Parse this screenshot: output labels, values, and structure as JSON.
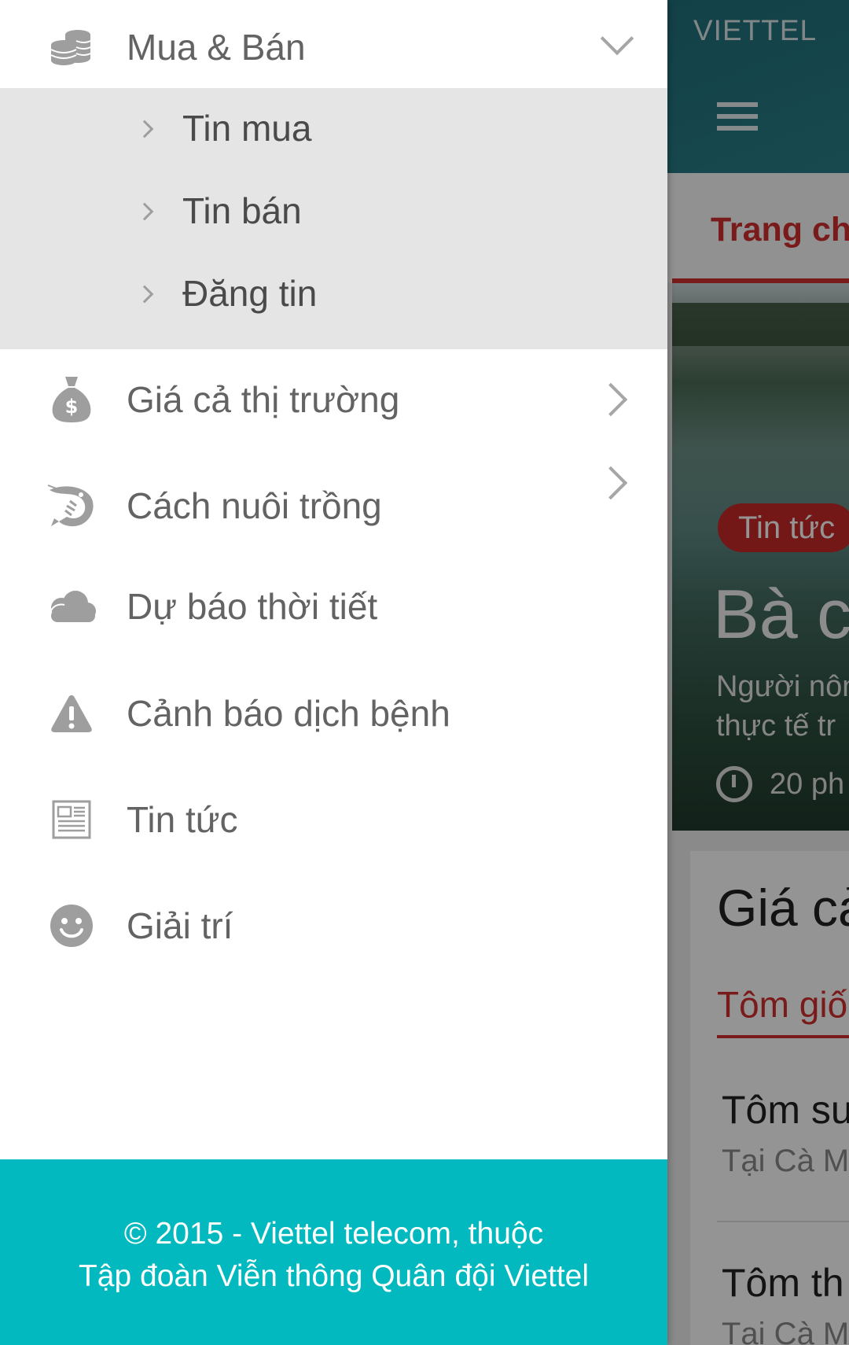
{
  "background": {
    "brand": "VIETTEL",
    "active_tab": "Trang chủ",
    "hero": {
      "badge": "Tin tức",
      "title": "Bà c",
      "subtitle_line1": "Người nôn",
      "subtitle_line2": "thực tế tr",
      "time": "20 ph"
    },
    "card": {
      "title": "Giá cả",
      "tab": "Tôm giố",
      "items": [
        {
          "name": "Tôm su",
          "location": "Tại Cà Ma"
        },
        {
          "name": "Tôm th",
          "location": "Tại Cà Ma"
        }
      ]
    }
  },
  "drawer": {
    "items": [
      {
        "label": "Mua & Bán",
        "icon": "coins-icon",
        "chevron": "down"
      },
      {
        "label": "Giá cả thị trường",
        "icon": "money-bag-icon",
        "chevron": "right"
      },
      {
        "label": "Cách nuôi trồng",
        "icon": "shrimp-icon",
        "chevron": "right"
      },
      {
        "label": "Dự báo thời tiết",
        "icon": "cloud-icon",
        "chevron": ""
      },
      {
        "label": "Cảnh báo dịch bệnh",
        "icon": "warning-icon",
        "chevron": ""
      },
      {
        "label": "Tin tức",
        "icon": "newspaper-icon",
        "chevron": ""
      },
      {
        "label": "Giải trí",
        "icon": "smiley-icon",
        "chevron": ""
      }
    ],
    "submenu": [
      {
        "label": "Tin mua"
      },
      {
        "label": "Tin bán"
      },
      {
        "label": "Đăng tin"
      }
    ],
    "footer": {
      "line1": "© 2015 - Viettel telecom, thuộc",
      "line2": "Tập đoàn Viễn thông Quân đội Viettel"
    }
  },
  "colors": {
    "accent_red": "#d32f2f",
    "footer_teal": "#01b9bf",
    "submenu_bg": "#e5e5e5",
    "icon_gray": "#9e9e9e"
  }
}
